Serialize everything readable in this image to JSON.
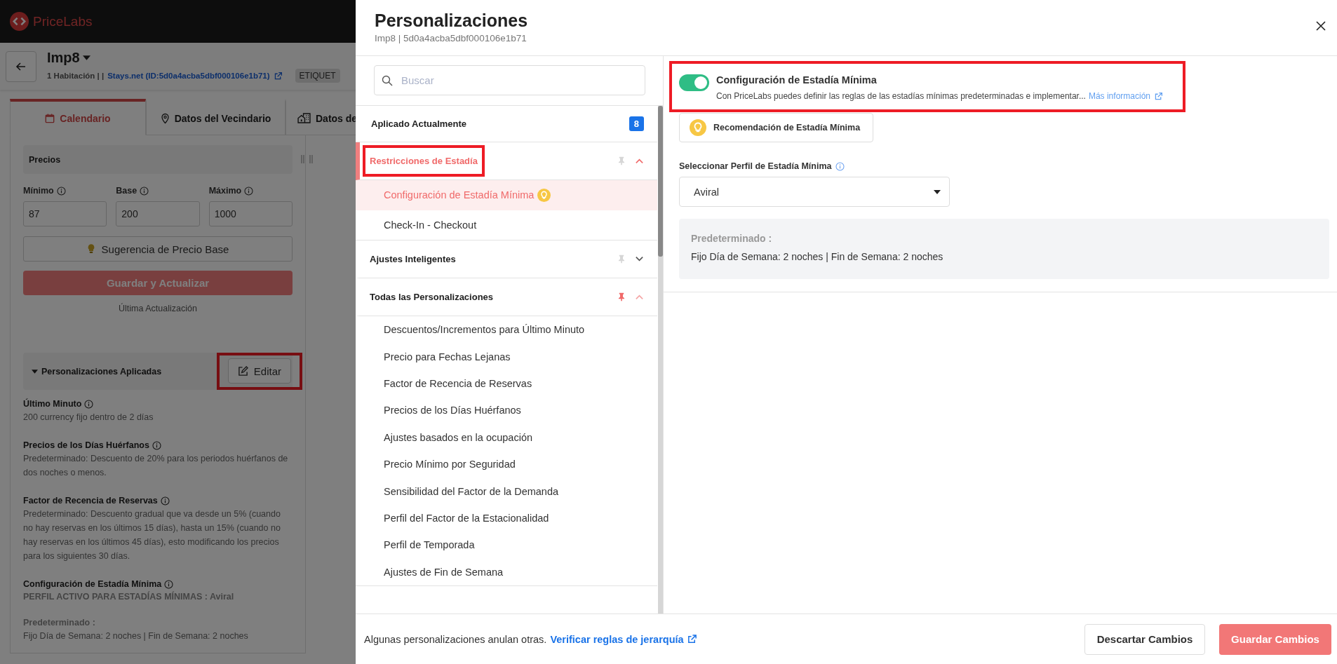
{
  "app": {
    "logo": "PriceLabs"
  },
  "listing": {
    "title": "Imp8",
    "rooms": "1 Habitación | |",
    "link": "Stays.net (ID:5d0a4acba5dbf000106e1b71)",
    "tag": "ETIQUET"
  },
  "tabs": [
    {
      "label": "Calendario",
      "selected": true
    },
    {
      "label": "Datos del Vecindario",
      "selected": false
    },
    {
      "label": "Datos de",
      "selected": false
    }
  ],
  "prices": {
    "title": "Precios",
    "fields": [
      {
        "label": "Mínimo",
        "value": "87"
      },
      {
        "label": "Base",
        "value": "200"
      },
      {
        "label": "Máximo",
        "value": "1000"
      }
    ],
    "suggestion_button": "Sugerencia de Precio Base",
    "save_button": "Guardar y Actualizar",
    "last_update": "Última Actualización"
  },
  "applied": {
    "title": "Personalizaciones Aplicadas",
    "edit_button": "Editar",
    "highlighted": true,
    "sections": [
      {
        "title": "Último Minuto",
        "lines": [
          {
            "kind": "text",
            "text": "200 currency fijo dentro de 2 días"
          }
        ]
      },
      {
        "title": "Precios de los Días Huérfanos",
        "lines": [
          {
            "kind": "text",
            "text": "Predeterminado: Descuento de 20% para los periodos huérfanos de dos noches o menos."
          }
        ]
      },
      {
        "title": "Factor de Recencia de Reservas",
        "lines": [
          {
            "kind": "text",
            "text": "Predeterminado: Descuento gradual que va desde un 5% (cuando no hay reservas en los últimos 15 días), hasta un 15% (cuando no hay reservas en los últimos 45 días), esto modificando los precios para los siguientes 30 días."
          }
        ]
      },
      {
        "title": "Configuración de Estadía Mínima",
        "lines": [
          {
            "kind": "strong",
            "text": "PERFIL ACTIVO PARA ESTADÍAS MÍNIMAS : Aviral"
          },
          {
            "kind": "gap_strong",
            "text": "Predeterminado :"
          },
          {
            "kind": "text",
            "text": "Fijo Día de Semana: 2 noches | Fin de Semana: 2 noches"
          }
        ]
      }
    ]
  },
  "modal": {
    "title": "Personalizaciones",
    "subtitle": "Imp8 | 5d0a4acba5dbf000106e1b71",
    "search": {
      "placeholder": "Buscar"
    },
    "applied_row": {
      "label": "Aplicado Actualmente",
      "count": "8"
    },
    "groups": [
      {
        "label": "Restricciones de Estadía",
        "selected": true,
        "expanded": true,
        "pinned": false,
        "highlighted": true,
        "children": [
          {
            "label": "Configuración de Estadía Mínima",
            "selected": true,
            "recommended": true
          },
          {
            "label": "Check-In - Checkout",
            "selected": false,
            "recommended": false
          }
        ]
      },
      {
        "label": "Ajustes Inteligentes",
        "selected": false,
        "expanded": false,
        "pinned": false,
        "highlighted": false
      },
      {
        "label": "Todas las Personalizaciones",
        "selected": false,
        "expanded": true,
        "pinned": true,
        "highlighted": false,
        "children": [
          {
            "label": "Descuentos/Incrementos para Último Minuto",
            "selected": false,
            "recommended": false
          },
          {
            "label": "Precio para Fechas Lejanas",
            "selected": false,
            "recommended": false
          },
          {
            "label": "Factor de Recencia de Reservas",
            "selected": false,
            "recommended": false
          },
          {
            "label": "Precios de los Días Huérfanos",
            "selected": false,
            "recommended": false
          },
          {
            "label": "Ajustes basados en la ocupación",
            "selected": false,
            "recommended": false
          },
          {
            "label": "Precio Mínimo por Seguridad",
            "selected": false,
            "recommended": false
          },
          {
            "label": "Sensibilidad del Factor de la Demanda",
            "selected": false,
            "recommended": false
          },
          {
            "label": "Perfil del Factor de la Estacionalidad",
            "selected": false,
            "recommended": false
          },
          {
            "label": "Perfil de Temporada",
            "selected": false,
            "recommended": false
          },
          {
            "label": "Ajustes de Fin de Semana",
            "selected": false,
            "recommended": false
          }
        ]
      }
    ],
    "setting": {
      "enabled": true,
      "highlighted": true,
      "title": "Configuración de Estadía Mínima",
      "description": "Con PriceLabs puedes definir las reglas de las estadías mínimas predeterminadas e implementar...",
      "more_link": "Más información",
      "recommend_button": "Recomendación de Estadía Mínima",
      "profile_label": "Seleccionar Perfil de Estadía Mínima",
      "profile_value": "Aviral",
      "default_title": "Predeterminado :",
      "default_text": "Fijo Día de Semana: 2 noches | Fin de Semana: 2 noches"
    },
    "footer": {
      "note": "Algunas personalizaciones anulan otras.",
      "link": "Verificar reglas de jerarquía",
      "buttons": [
        {
          "label": "Descartar Cambios",
          "kind": "secondary"
        },
        {
          "label": "Guardar Cambios",
          "kind": "primary"
        }
      ]
    }
  }
}
